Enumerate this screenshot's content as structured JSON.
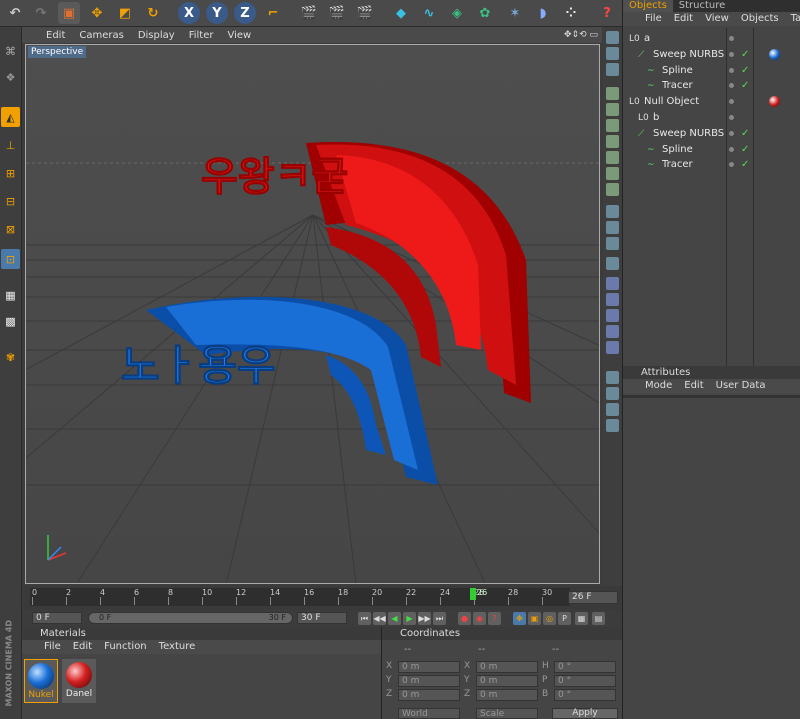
{
  "viewport": {
    "menu": [
      "Edit",
      "Cameras",
      "Display",
      "Filter",
      "View"
    ],
    "camera_label": "Perspective"
  },
  "objects": {
    "tabs": [
      "Objects",
      "Structure"
    ],
    "menu": [
      "File",
      "Edit",
      "View",
      "Objects",
      "Tags"
    ],
    "tree": [
      {
        "name": "a",
        "indent": 0,
        "icon": "null-object-icon"
      },
      {
        "name": "Sweep NURBS",
        "indent": 1,
        "icon": "sweep-nurbs-icon"
      },
      {
        "name": "Spline",
        "indent": 2,
        "icon": "spline-icon"
      },
      {
        "name": "Tracer",
        "indent": 2,
        "icon": "tracer-icon"
      },
      {
        "name": "Null Object",
        "indent": 0,
        "icon": "null-object-icon"
      },
      {
        "name": "b",
        "indent": 1,
        "icon": "null-object-icon"
      },
      {
        "name": "Sweep NURBS",
        "indent": 1,
        "icon": "sweep-nurbs-icon"
      },
      {
        "name": "Spline",
        "indent": 2,
        "icon": "spline-icon"
      },
      {
        "name": "Tracer",
        "indent": 2,
        "icon": "tracer-icon"
      }
    ]
  },
  "attributes": {
    "title": "Attributes",
    "menu": [
      "Mode",
      "Edit",
      "User Data"
    ]
  },
  "timeline": {
    "ticks": [
      "0",
      "2",
      "4",
      "6",
      "8",
      "10",
      "12",
      "14",
      "16",
      "18",
      "20",
      "22",
      "24",
      "26",
      "28",
      "30"
    ],
    "current_frame": "26",
    "frame_field": "26 F"
  },
  "playback": {
    "start": "0 F",
    "slider_left": "0 F",
    "slider_right": "30 F",
    "end": "30 F"
  },
  "materials": {
    "title": "Materials",
    "menu": [
      "File",
      "Edit",
      "Function",
      "Texture"
    ],
    "items": [
      {
        "name": "Nukel",
        "color": "#1a6fd6"
      },
      {
        "name": "Danel",
        "color": "#d42020"
      }
    ]
  },
  "coordinates": {
    "title": "Coordinates",
    "rows": [
      {
        "a": "X",
        "av": "0 m",
        "b": "X",
        "bv": "0 m",
        "c": "H",
        "cv": "0 °"
      },
      {
        "a": "Y",
        "av": "0 m",
        "b": "Y",
        "bv": "0 m",
        "c": "P",
        "cv": "0 °"
      },
      {
        "a": "Z",
        "av": "0 m",
        "b": "Z",
        "bv": "0 m",
        "c": "B",
        "cv": "0 °"
      }
    ],
    "dash": "--",
    "world": "World",
    "scale": "Scale",
    "apply": "Apply"
  },
  "scene_text": {
    "red": "우왕ㅋ굳",
    "blue": "노ㅏ용우"
  },
  "sidebar_caption": "MAXON CINEMA 4D"
}
